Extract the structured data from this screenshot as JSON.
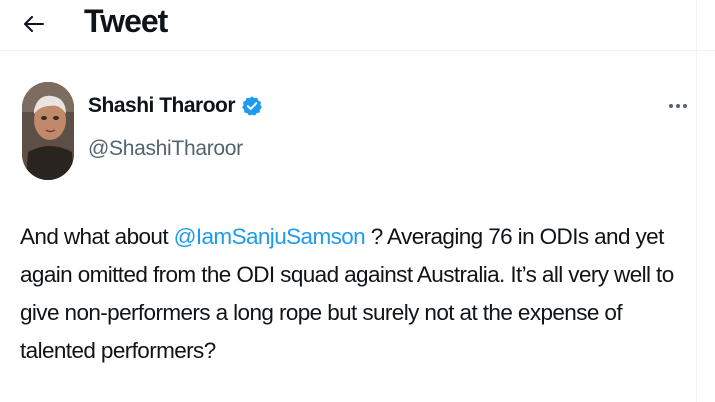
{
  "header": {
    "title": "Tweet",
    "back_icon": "arrow-left-icon"
  },
  "author": {
    "name": "Shashi Tharoor",
    "handle": "@ShashiTharoor",
    "verified_icon": "verified-badge-icon",
    "verified_color": "#1d9bf0",
    "more_icon": "more-horizontal-icon"
  },
  "tweet": {
    "text_before": "And what about ",
    "mention": "@IamSanjuSamson",
    "text_after": " ? Averaging 76 in ODIs and yet again omitted from the ODI squad against Australia. It’s all very well to give non-performers a long rope but surely not at the expense of talented performers?",
    "mention_color": "#1d9bf0"
  }
}
